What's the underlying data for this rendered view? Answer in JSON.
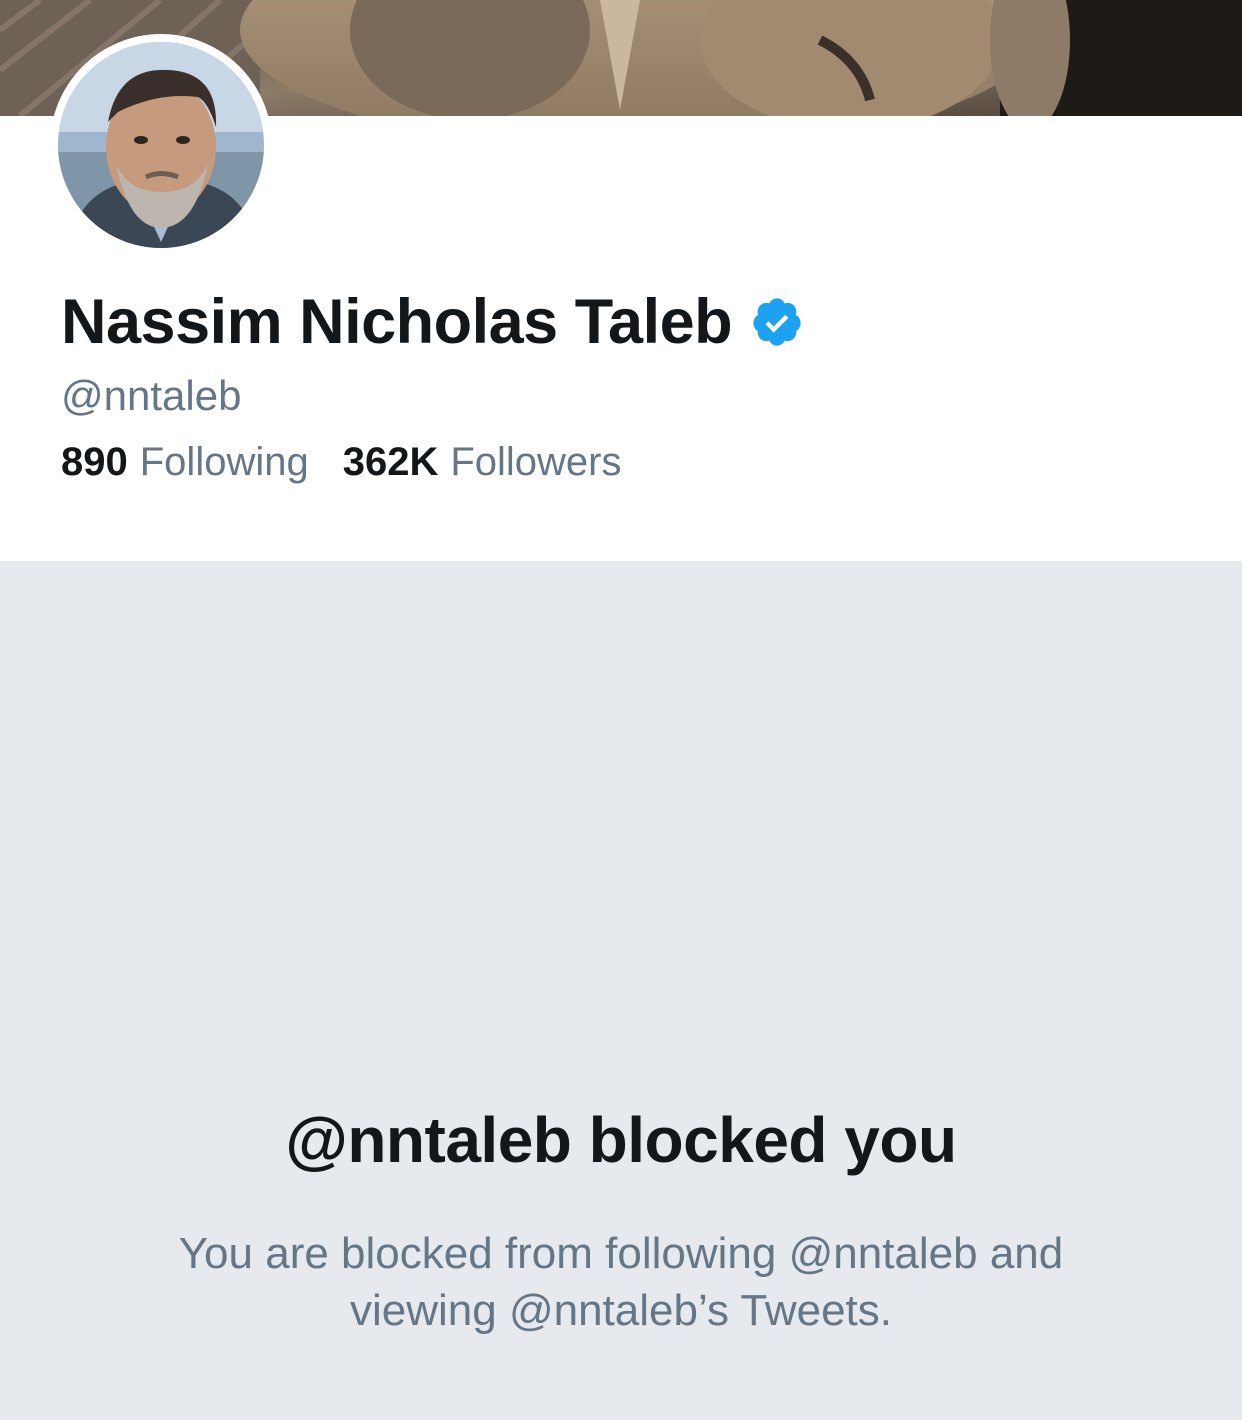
{
  "profile": {
    "display_name": "Nassim Nicholas Taleb",
    "verified": true,
    "handle": "@nntaleb",
    "following_count": "890",
    "following_label": "Following",
    "followers_count": "362K",
    "followers_label": "Followers"
  },
  "blocked": {
    "title": "@nntaleb blocked you",
    "description": "You are blocked from following @nntaleb and viewing @nntaleb’s Tweets."
  },
  "colors": {
    "text_primary": "#14171a",
    "text_secondary": "#657786",
    "verified_blue": "#1da1f2",
    "panel_background": "#e6e9ed"
  },
  "icons": {
    "verified": "verified-badge-icon"
  }
}
